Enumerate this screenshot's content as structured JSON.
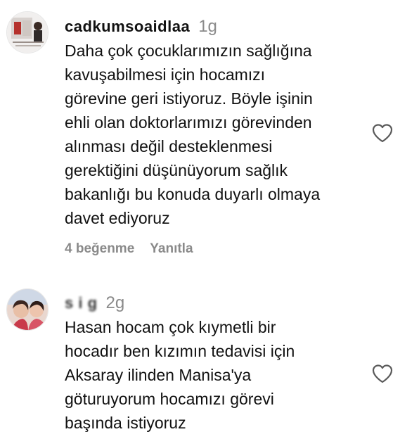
{
  "comments": [
    {
      "username": "cadkumsoaidlaa",
      "time": "1g",
      "lines": [
        "Daha çok çocuklarımızın sağlığına",
        "kavuşabilmesi için hocamızı",
        "görevine geri istiyoruz. Böyle işinin",
        "ehli olan doktorlarımızı görevinden",
        "alınması değil desteklenmesi",
        "gerektiğini düşünüyorum sağlık",
        "bakanlığı bu konuda duyarlı olmaya",
        "davet ediyoruz"
      ],
      "likes_label": "4 beğenme",
      "reply_label": "Yanıtla",
      "like_icon": "heart-outline-icon"
    },
    {
      "username": "s   i    g",
      "time": "2g",
      "lines": [
        "Hasan hocam çok kıymetli bir",
        "hocadır ben kızımın tedavisi için",
        "Aksaray ilinden Manisa'ya",
        "göturuyorum hocamızı görevi",
        "başında istiyoruz"
      ],
      "like_icon": "heart-outline-icon"
    }
  ],
  "colors": {
    "text": "#111111",
    "muted": "#8a8a8a",
    "background": "#ffffff"
  }
}
